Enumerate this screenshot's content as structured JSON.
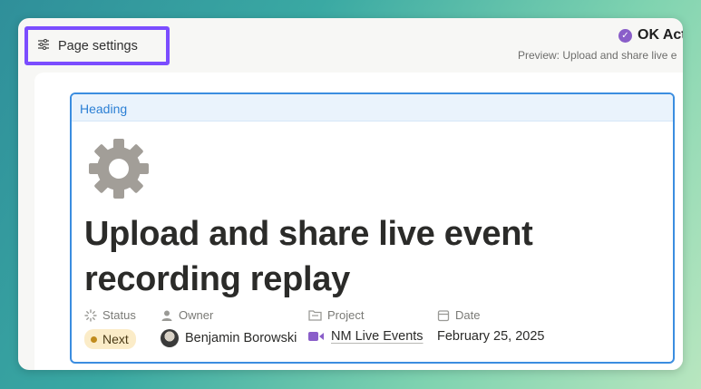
{
  "toolbar": {
    "page_settings_label": "Page settings",
    "status_title": "OK Act",
    "preview_text": "Preview: Upload and share live e"
  },
  "card": {
    "block_type": "Heading",
    "icon": "gear-icon",
    "title": "Upload and share live event recording replay"
  },
  "properties": {
    "status": {
      "label": "Status",
      "value": "Next"
    },
    "owner": {
      "label": "Owner",
      "value": "Benjamin Borowski"
    },
    "project": {
      "label": "Project",
      "value": "NM Live Events"
    },
    "date": {
      "label": "Date",
      "value": "February 25, 2025"
    }
  },
  "colors": {
    "highlight": "#7b4dff",
    "card_border": "#3b8de0",
    "status_badge_bg": "#fbecc8",
    "project_icon": "#8a5ec9"
  }
}
